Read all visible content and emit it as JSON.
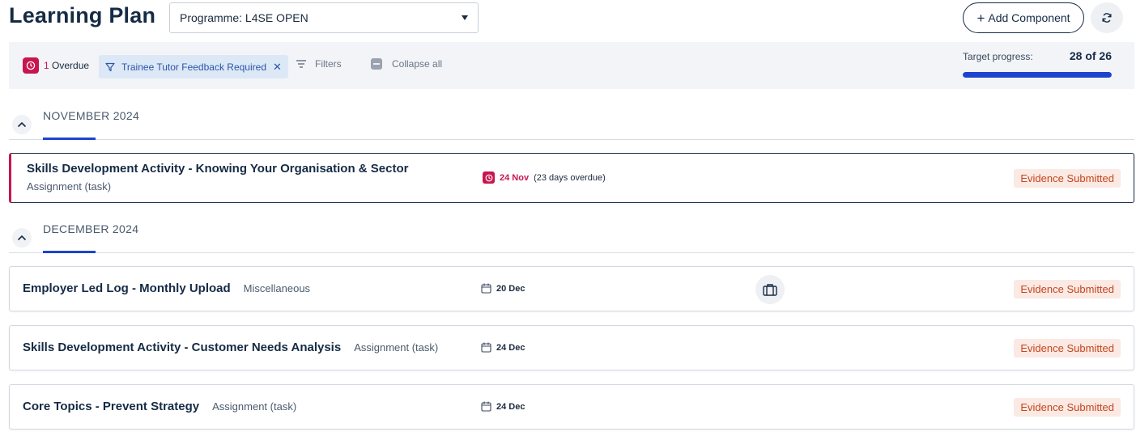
{
  "header": {
    "title": "Learning Plan",
    "programme_select_value": "Programme: L4SE OPEN",
    "add_component_label": "Add Component"
  },
  "filter_bar": {
    "overdue_count": "1",
    "overdue_label": "Overdue",
    "active_filter_label": "Trainee Tutor Feedback Required",
    "filters_label": "Filters",
    "collapse_all_label": "Collapse all",
    "target_progress_label": "Target progress:",
    "target_progress_value": "28 of 26",
    "target_progress_fraction": 1.0
  },
  "months": [
    {
      "label": "NOVEMBER 2024",
      "tasks": [
        {
          "title": "Skills Development Activity - Knowing Your Organisation & Sector",
          "type": "Assignment (task)",
          "due": "24 Nov",
          "overdue_note": "(23 days overdue)",
          "status": "Evidence Submitted"
        }
      ]
    },
    {
      "label": "DECEMBER 2024",
      "tasks": [
        {
          "title": "Employer Led Log - Monthly Upload",
          "type": "Miscellaneous",
          "due": "20 Dec",
          "status": "Evidence Submitted"
        },
        {
          "title": "Skills Development Activity - Customer Needs Analysis",
          "type": "Assignment (task)",
          "due": "24 Dec",
          "status": "Evidence Submitted"
        },
        {
          "title": "Core Topics - Prevent Strategy",
          "type": "Assignment (task)",
          "due": "24 Dec",
          "status": "Evidence Submitted"
        }
      ]
    }
  ],
  "colors": {
    "accent": "#1d44cc",
    "overdue": "#c8154f",
    "status_text": "#c4461c",
    "status_bg": "#fbe9e4"
  },
  "icons": {
    "overdue": "clock-icon",
    "filter": "funnel-icon",
    "filters": "filter-lines-icon",
    "collapse": "minus-square-icon",
    "refresh": "refresh-icon",
    "due": "calendar-icon",
    "employer": "briefcase-icon"
  }
}
